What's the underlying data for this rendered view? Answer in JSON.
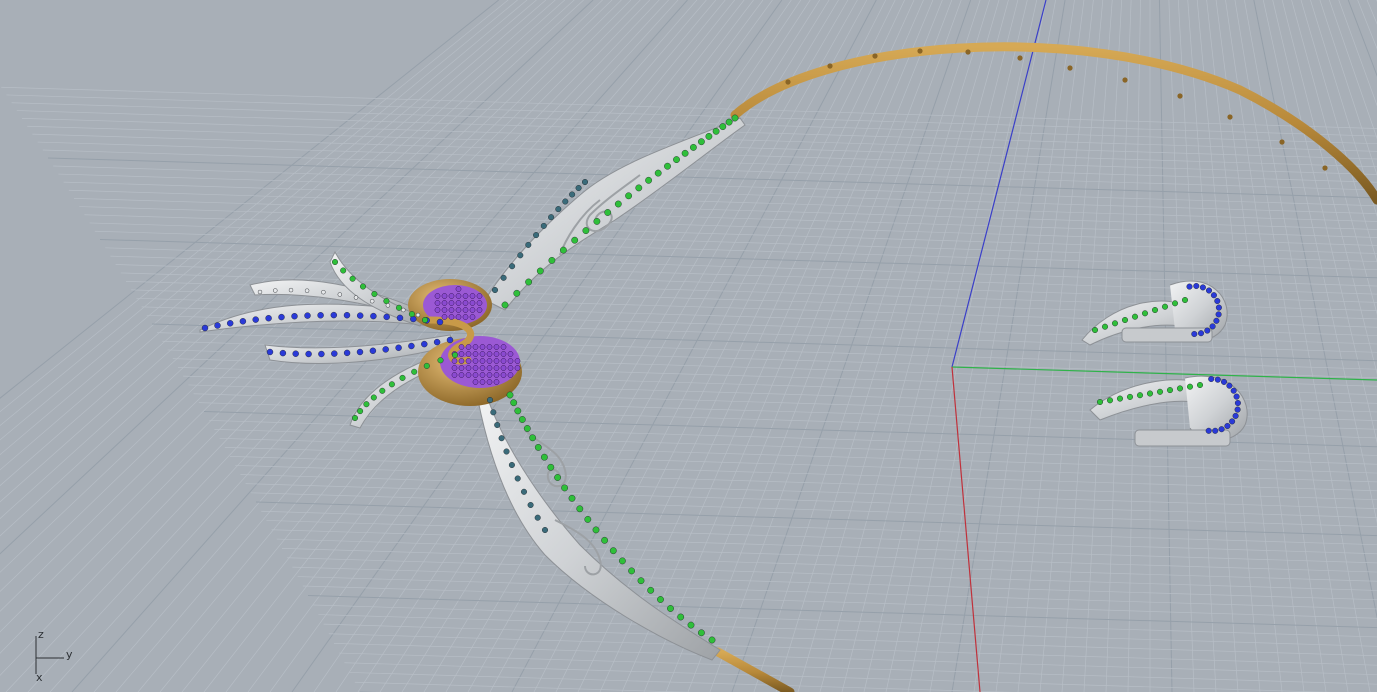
{
  "viewport": {
    "background_color": "#a8afb7",
    "grid_minor_color": "#b7bec6",
    "grid_major_color": "#96a0aa",
    "axis_x_color": "#c0313b",
    "axis_y_color": "#2fb34a",
    "axis_z_color": "#3a3fc8"
  },
  "materials": {
    "gold": "#b8893a",
    "silver": "#d4d6d8",
    "gem_green": "#2fbf3a",
    "gem_blue": "#2a3ad8",
    "gem_purple": "#8a4ad0",
    "gem_teal": "#3a6b7a"
  },
  "axis_gizmo": {
    "z_label": "z",
    "y_label": "y",
    "x_label": "x"
  }
}
